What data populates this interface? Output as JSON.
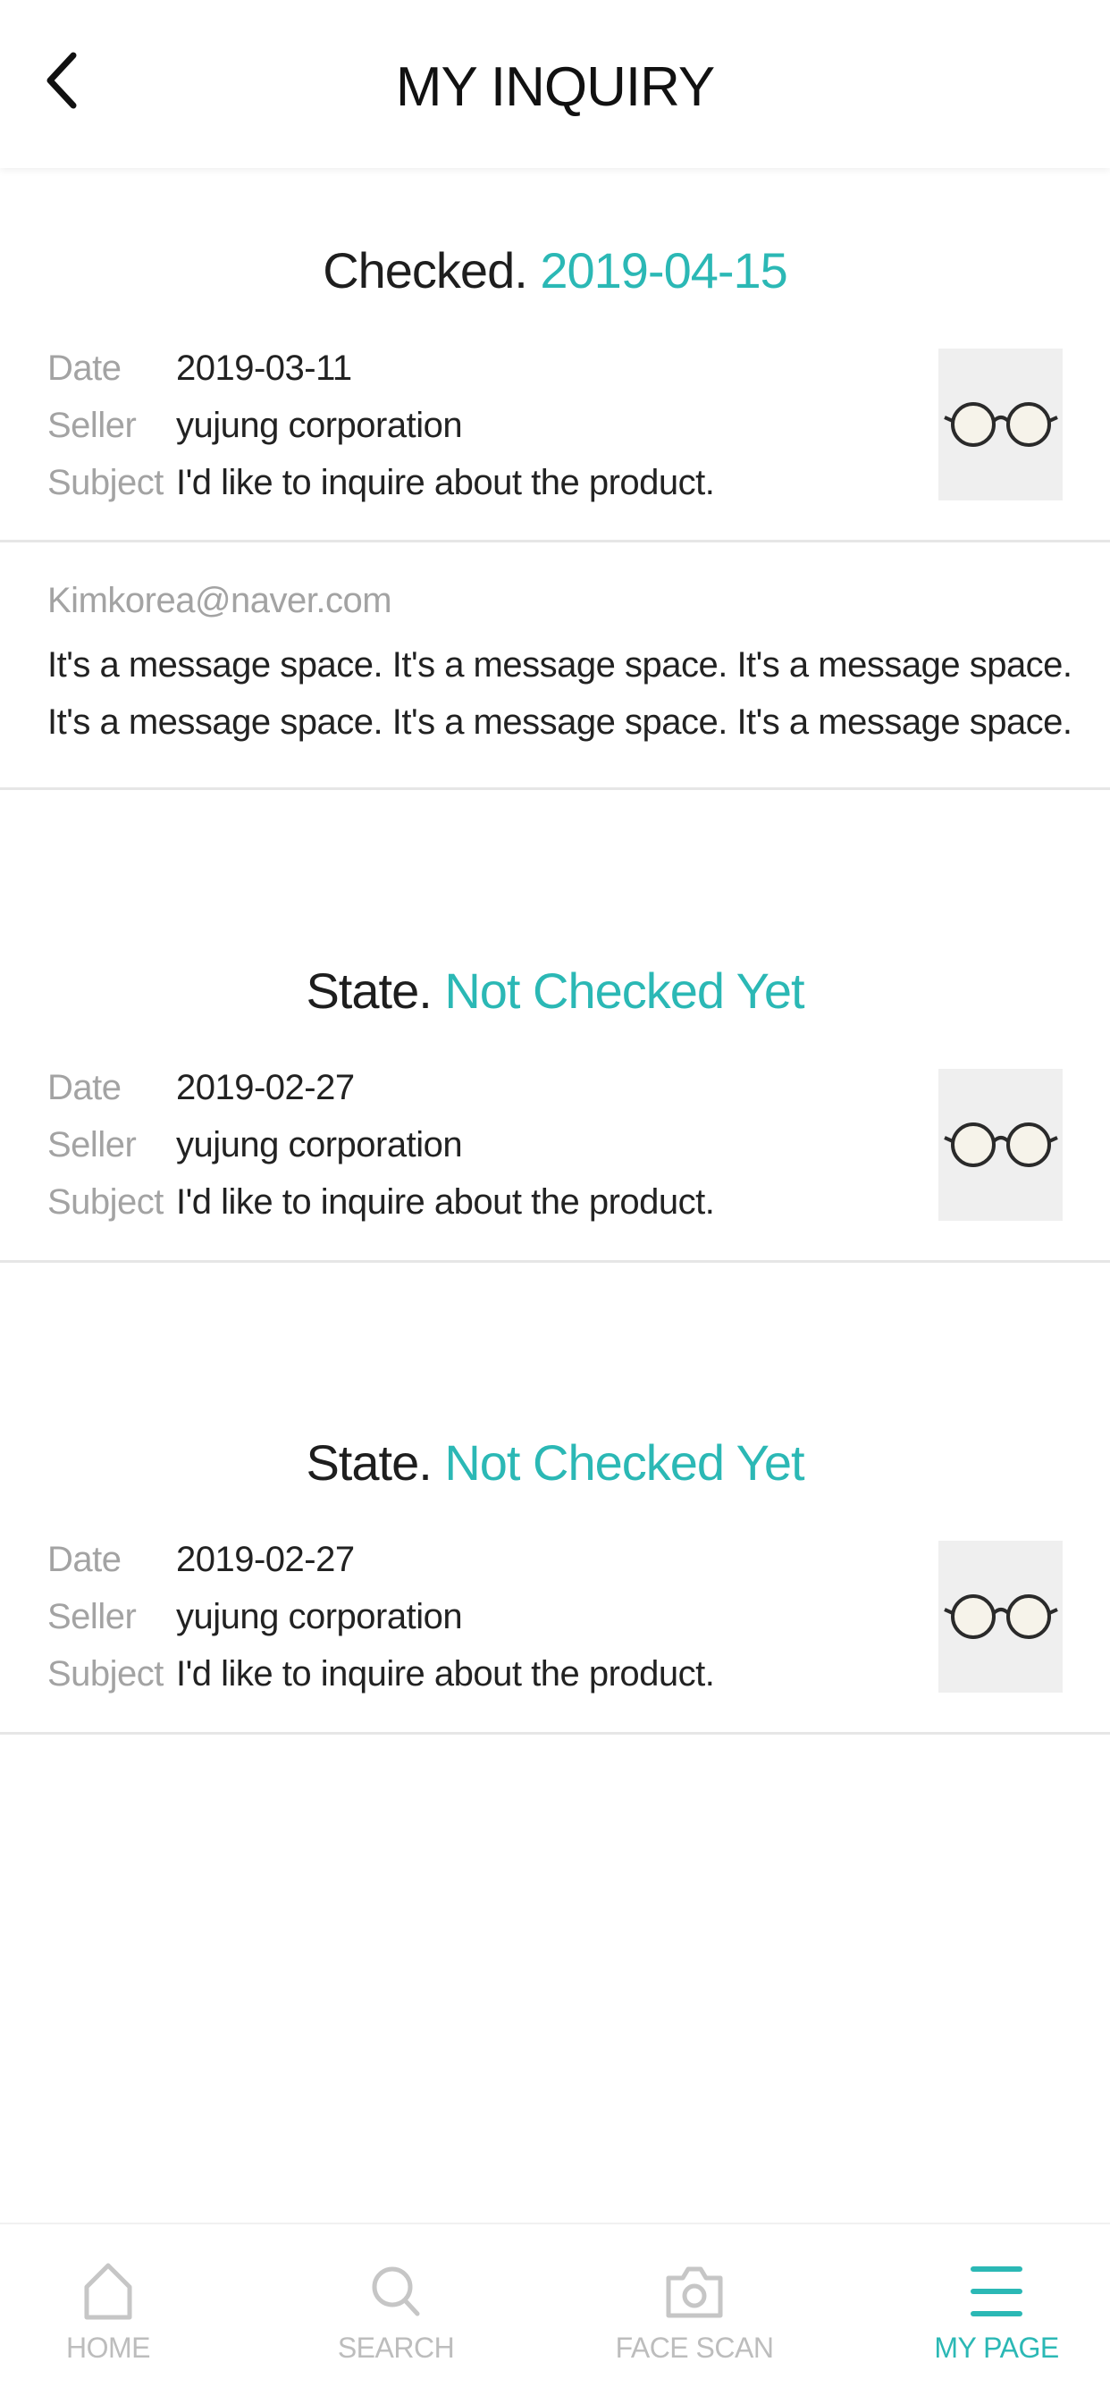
{
  "header": {
    "title": "MY INQUIRY"
  },
  "inquiries": [
    {
      "status_prefix": "Checked.",
      "status_value": "2019-04-15",
      "date_label": "Date",
      "date": "2019-03-11",
      "seller_label": "Seller",
      "seller": "yujung corporation",
      "subject_label": "Subject",
      "subject": "I'd like to inquire about the product.",
      "email": "Kimkorea@naver.com",
      "message_lines": [
        "It's a message space. It's a message space. It's a message space.",
        "It's a message space. It's a message space. It's a message space."
      ]
    },
    {
      "status_prefix": "State.",
      "status_value": "Not Checked Yet",
      "date_label": "Date",
      "date": "2019-02-27",
      "seller_label": "Seller",
      "seller": "yujung corporation",
      "subject_label": "Subject",
      "subject": "I'd like to inquire about the product."
    },
    {
      "status_prefix": "State.",
      "status_value": "Not Checked Yet",
      "date_label": "Date",
      "date": "2019-02-27",
      "seller_label": "Seller",
      "seller": "yujung corporation",
      "subject_label": "Subject",
      "subject": "I'd like to inquire about the product."
    }
  ],
  "tabs": [
    {
      "label": "HOME",
      "icon": "home-icon"
    },
    {
      "label": "SEARCH",
      "icon": "search-icon"
    },
    {
      "label": "FACE SCAN",
      "icon": "camera-icon"
    },
    {
      "label": "MY PAGE",
      "icon": "menu-icon",
      "active": true
    }
  ],
  "colors": {
    "accent": "#2bb8b5",
    "label_gray": "#a3a3a3",
    "divider": "#e6e6e6"
  }
}
